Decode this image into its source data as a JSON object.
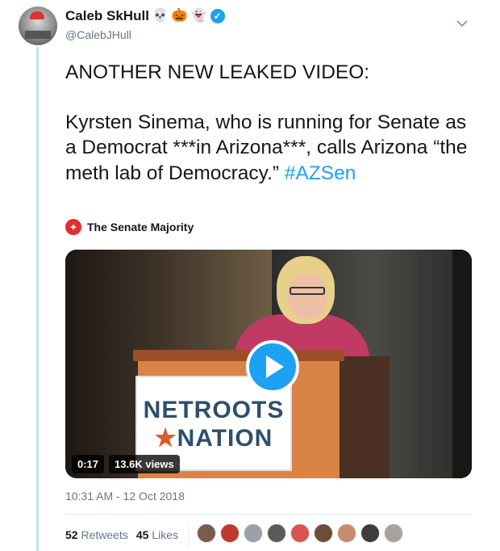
{
  "author": {
    "name": "Caleb SkHull",
    "name_emojis": [
      "💀",
      "🎃",
      "👻"
    ],
    "handle": "@CalebJHull",
    "verified": true
  },
  "tweet": {
    "line1": "ANOTHER NEW LEAKED VIDEO:",
    "body": "Kyrsten Sinema, who is running for Senate as a Democrat ***in Arizona***, calls Arizona “the meth lab of Democracy.” ",
    "hashtag": "#AZSen"
  },
  "attribution": {
    "source": "The Senate Majority"
  },
  "video": {
    "sign_line1": "NETROOTS",
    "sign_line2": "NATION",
    "duration": "0:17",
    "views": "13.6K views"
  },
  "timestamp": "10:31 AM - 12 Oct 2018",
  "stats": {
    "retweets_count": "52",
    "retweets_label": "Retweets",
    "likes_count": "45",
    "likes_label": "Likes"
  },
  "likers": [
    "#7b5b4a",
    "#c0392b",
    "#9aa0a6",
    "#5a5a5a",
    "#d9534f",
    "#6b4f3a",
    "#c98b6b",
    "#3d3d3d",
    "#a8a29e"
  ],
  "colors": {
    "accent": "#1da1f2",
    "thread_line": "#bfe3f5",
    "text_secondary": "#657786"
  }
}
